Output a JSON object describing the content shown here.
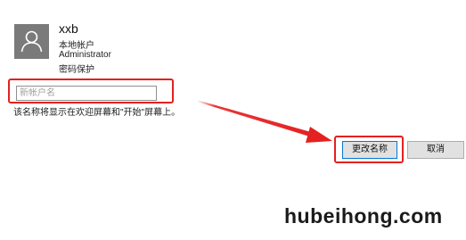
{
  "account": {
    "username": "xxb",
    "type": "本地帐户",
    "role": "Administrator",
    "security": "密码保护"
  },
  "rename": {
    "placeholder": "新帐户名",
    "hint": "该名称将显示在欢迎屏幕和\"开始\"屏幕上。"
  },
  "buttons": {
    "confirm": "更改名称",
    "cancel": "取消"
  },
  "annotation": {
    "highlight_color": "#e52020",
    "icon": "user-icon"
  },
  "watermark": "hubeihong.com"
}
